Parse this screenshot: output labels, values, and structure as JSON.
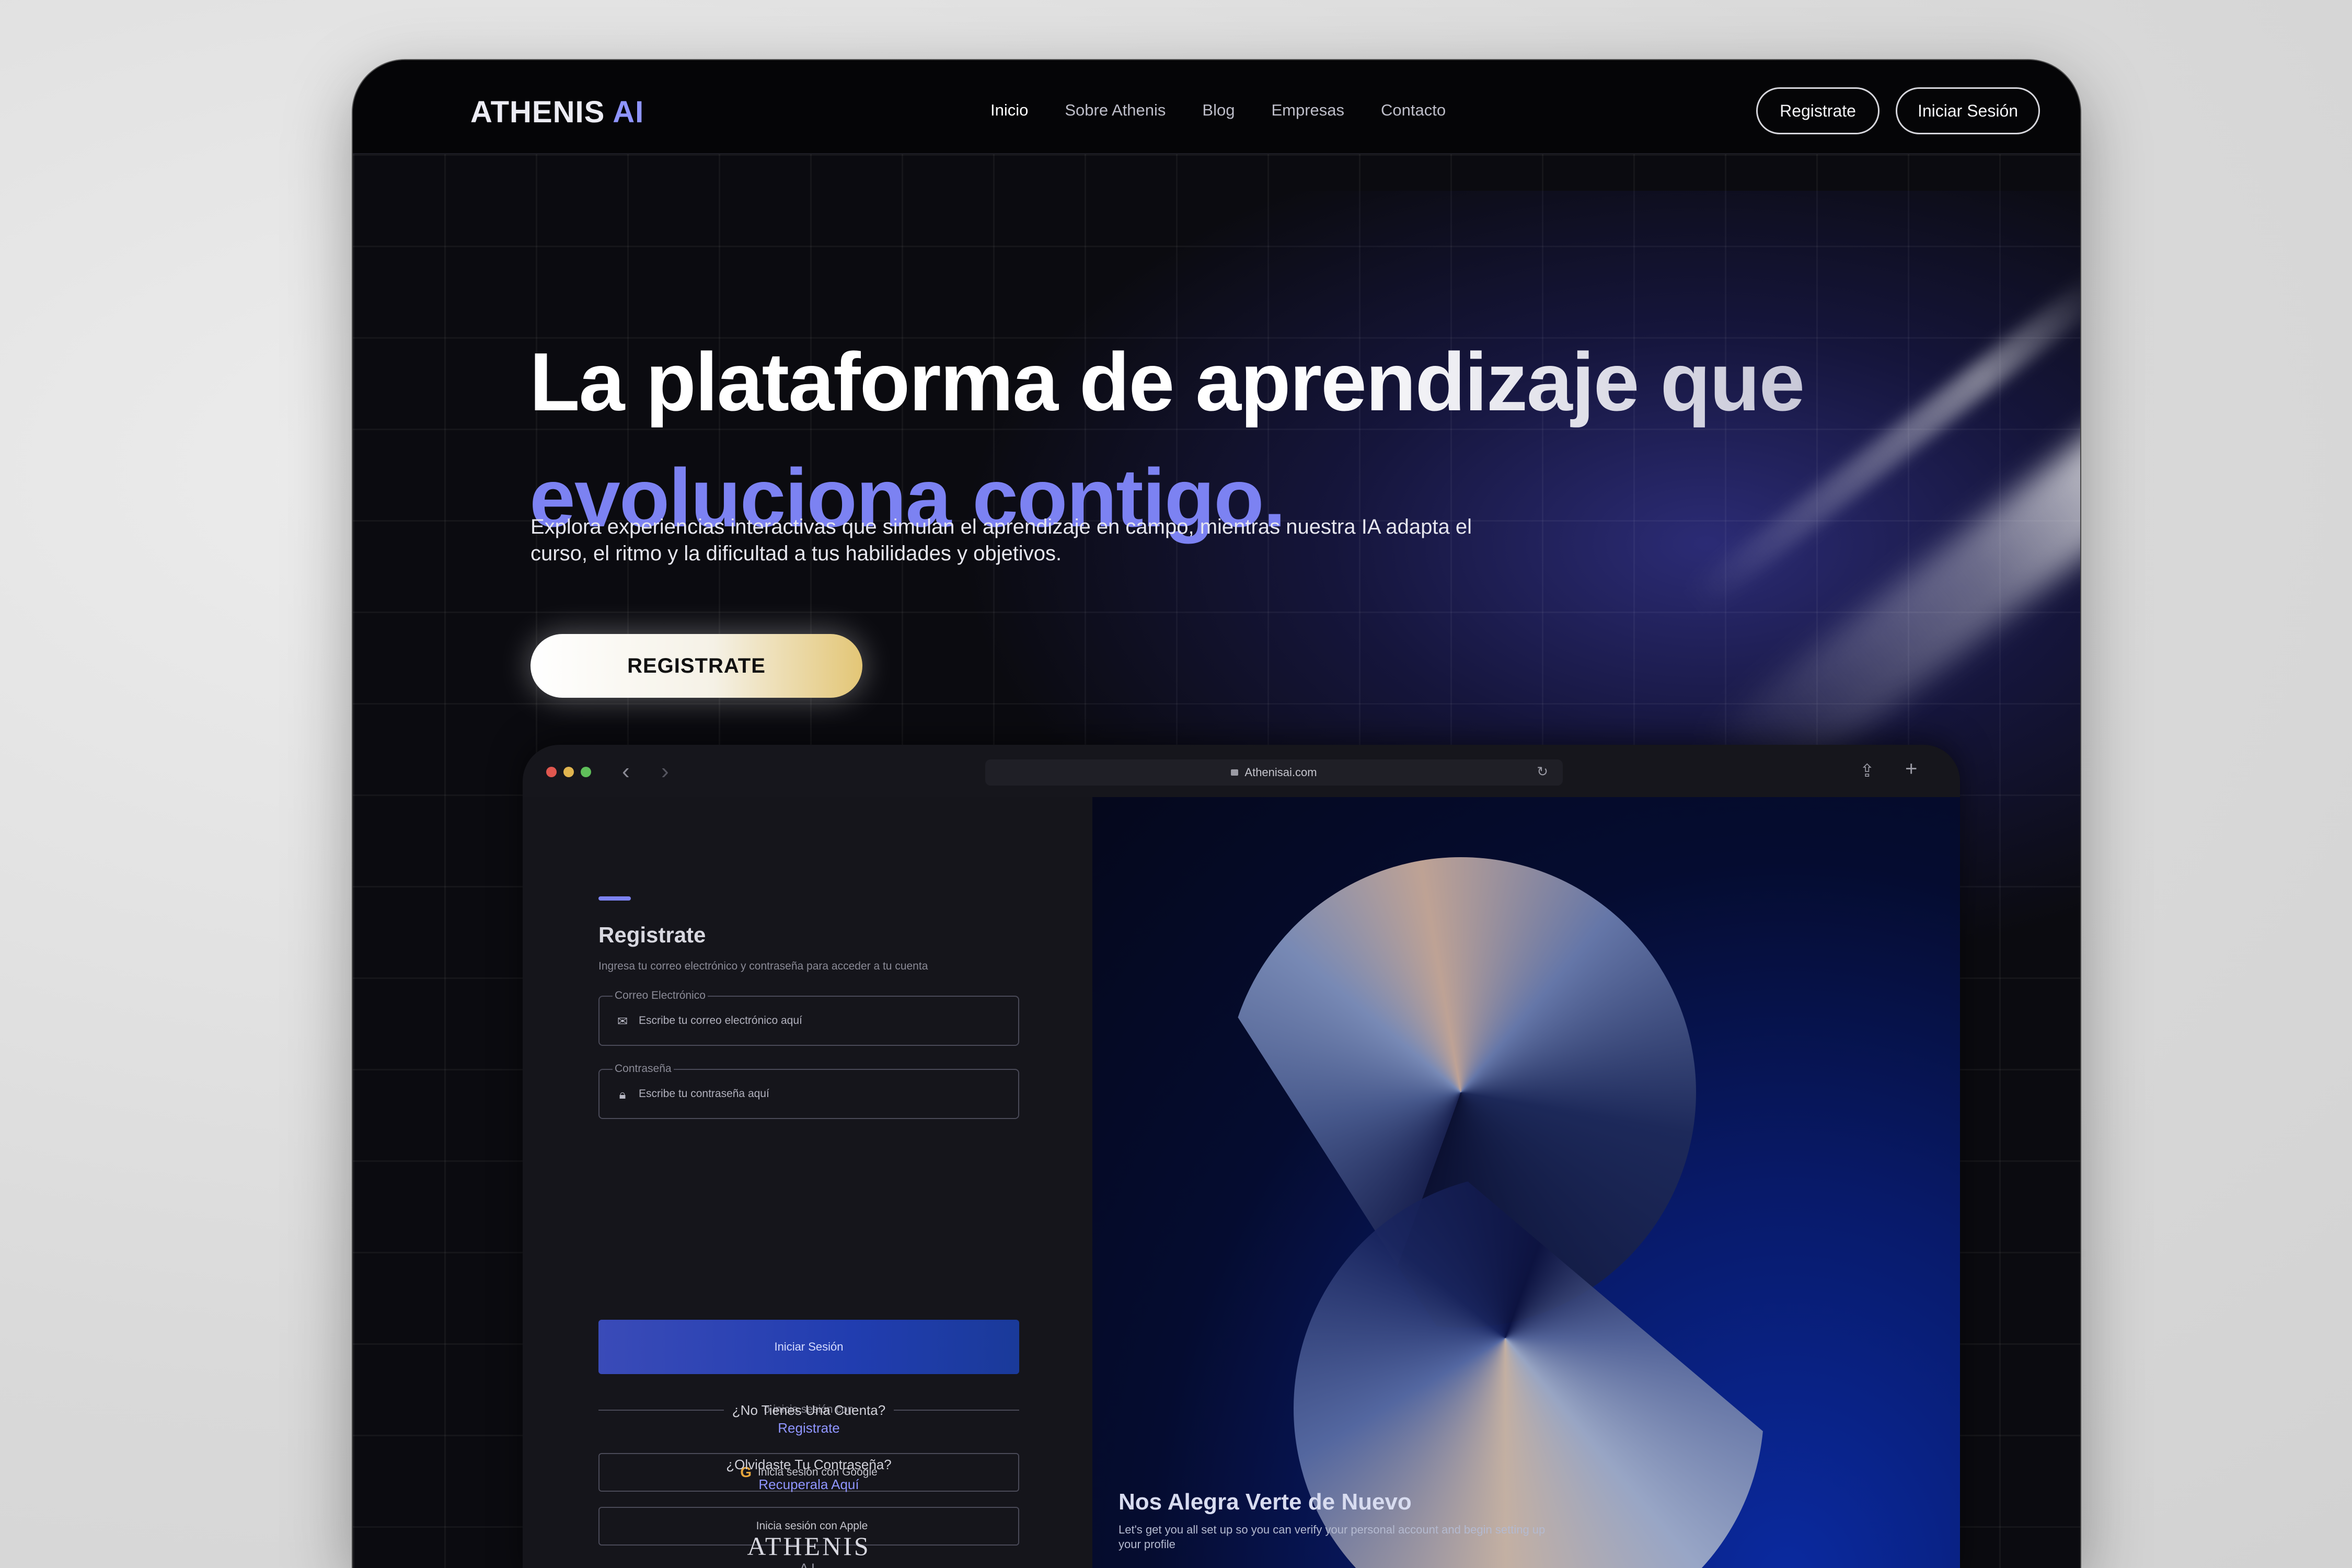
{
  "nav": {
    "logo_main": "ATHENIS",
    "logo_ai": "AI",
    "links": [
      "Inicio",
      "Sobre Athenis",
      "Blog",
      "Empresas",
      "Contacto"
    ],
    "register_button": "Registrate",
    "login_button": "Iniciar Sesión"
  },
  "hero": {
    "title_line1": "La plataforma de aprendizaje que",
    "title_line2": "evoluciona contigo.",
    "subtitle": "Explora experiencias interactivas que simulan el aprendizaje en campo, mientras nuestra IA adapta el curso, el ritmo y la dificultad a tus habilidades y objetivos.",
    "cta": "REGISTRATE"
  },
  "browser": {
    "url": "Athenisai.com",
    "form": {
      "title": "Registrate",
      "subtitle": "Ingresa tu correo electrónico y contraseña para acceder a tu cuenta",
      "email_label": "Correo Electrónico",
      "email_placeholder": "Escribe tu correo electrónico aquí",
      "password_label": "Contraseña",
      "password_placeholder": "Escribe tu contraseña aquí",
      "login_button": "Iniciar Sesión",
      "divider": "o inicia sesión con",
      "google": "Inicia sesión con Google",
      "apple": "Inicia sesión con Apple",
      "no_account": "¿No Tienes Una Cuenta?",
      "register_link": "Registrate",
      "forgot": "¿Olvidaste Tu Contraseña?",
      "recover_link": "Recuperala Aquí",
      "footer_logo": "ATHENIS",
      "footer_ai": "AI"
    },
    "panel": {
      "title": "Nos Alegra Verte de Nuevo",
      "subtitle": "Let's get you all set up so you can verify your personal account and begin setting up your profile"
    }
  },
  "colors": {
    "accent": "#7c82f2",
    "button_blue": "#213db0",
    "background": "#0b0b10"
  }
}
